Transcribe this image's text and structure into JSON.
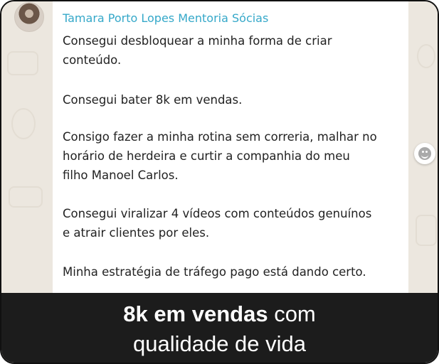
{
  "message": {
    "sender": "Tamara Porto Lopes Mentoria Sócias",
    "paragraphs": [
      {
        "lines": [
          "Consegui desbloquear a minha forma de criar",
          "conteúdo."
        ]
      },
      {
        "lines": [
          "Consegui bater 8k em vendas."
        ]
      },
      {
        "lines": [
          "Consigo fazer a minha rotina sem correria, malhar no",
          "horário de herdeira e curtir a companhia do meu",
          "filho Manoel Carlos."
        ]
      },
      {
        "lines": [
          "Consegui viralizar 4 vídeos com conteúdos genuínos",
          "e atrair clientes por eles."
        ]
      },
      {
        "lines": [
          "Minha estratégia de tráfego pago está dando certo."
        ]
      }
    ]
  },
  "icons": {
    "avatar": "avatar-photo",
    "emoji": "emoji-reaction-icon"
  },
  "caption": {
    "bold": "8k em vendas",
    "rest_line1": " com",
    "line2": "qualidade de vida"
  },
  "colors": {
    "sender": "#35a8c9",
    "caption_bg": "#1c1c1c",
    "chat_bg": "#ece7df"
  }
}
